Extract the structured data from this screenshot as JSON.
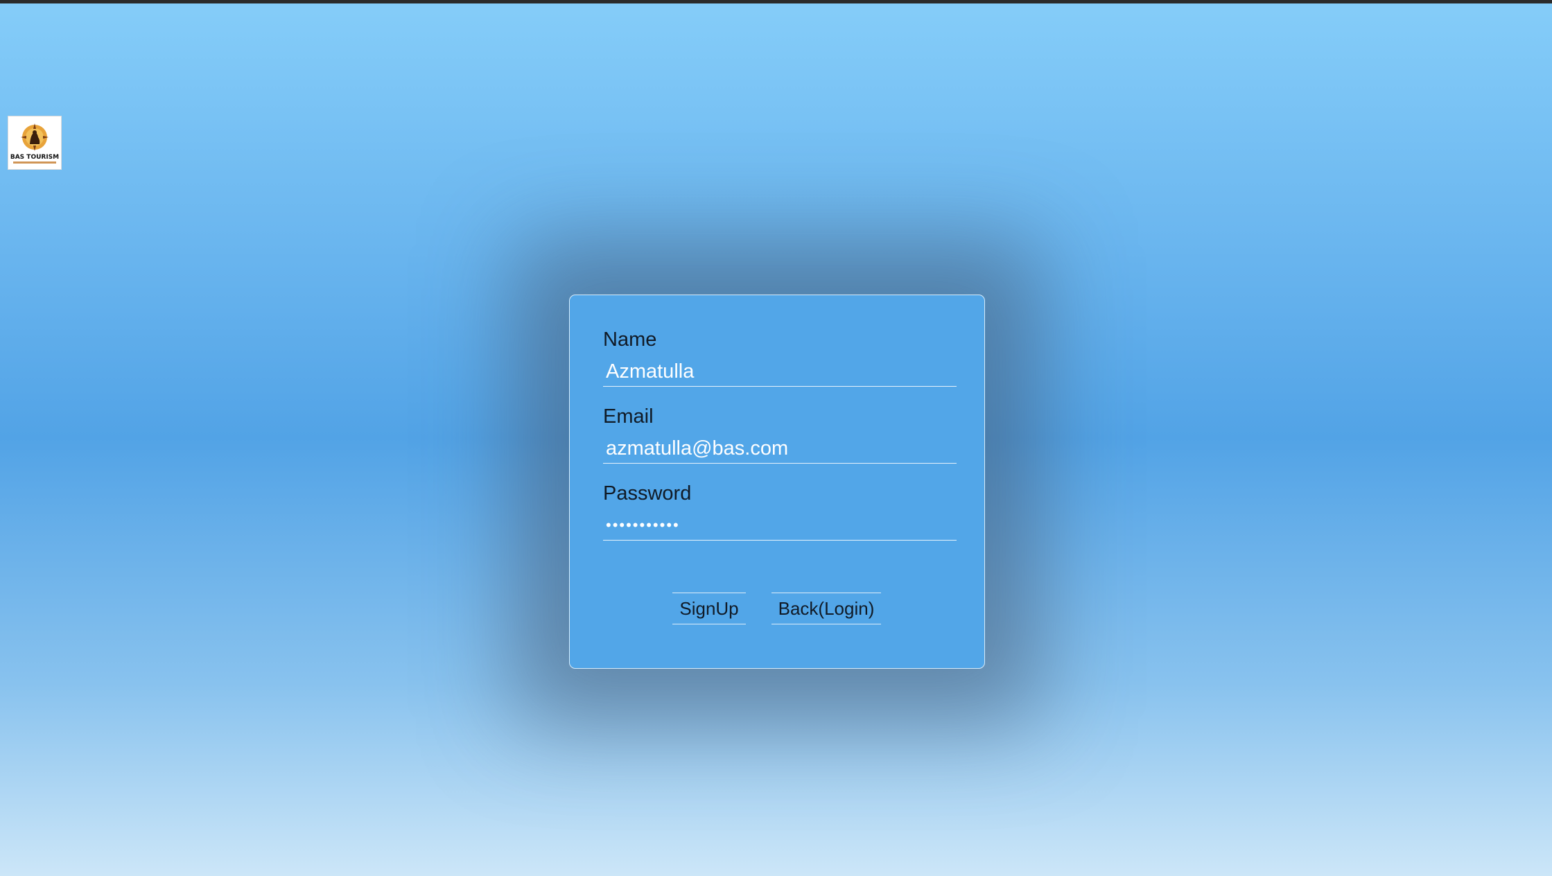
{
  "logo": {
    "name": "BAS TOURISM"
  },
  "form": {
    "name_label": "Name",
    "name_value": "Azmatulla",
    "email_label": "Email",
    "email_value": "azmatulla@bas.com",
    "password_label": "Password",
    "password_value": "•••••••••••"
  },
  "buttons": {
    "signup": "SignUp",
    "back_login": "Back(Login)"
  },
  "colors": {
    "card_background": "#52a6e8",
    "input_text": "#ffffff",
    "label_text": "#101a26"
  }
}
